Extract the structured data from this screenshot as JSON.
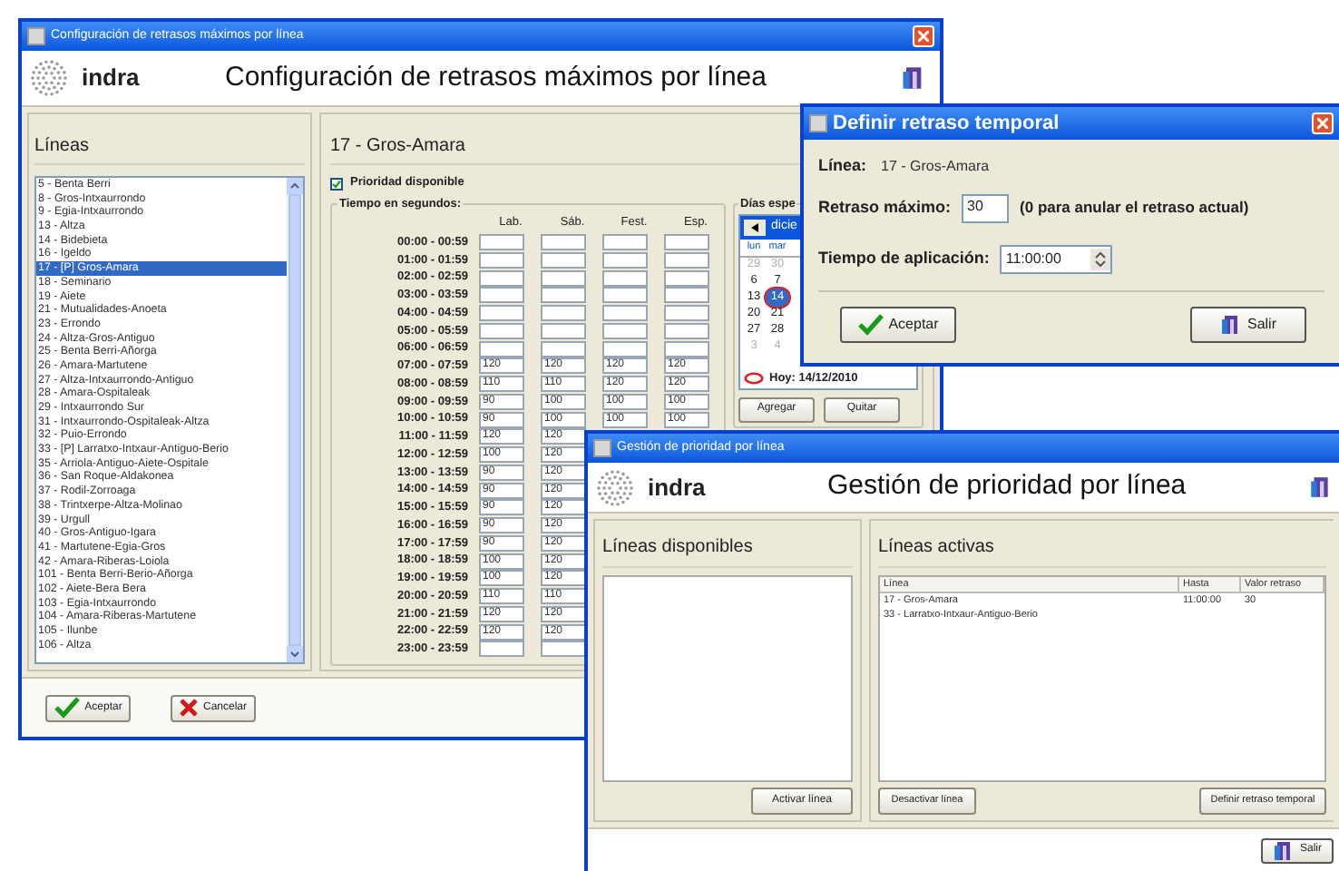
{
  "main_window": {
    "title": "Configuración de retrasos máximos por línea",
    "logo_text": "indra",
    "header_title": "Configuración de retrasos máximos por línea",
    "lines_label": "Líneas",
    "lines": [
      {
        "label": "5 - Benta Berri",
        "selected": false
      },
      {
        "label": "8 - Gros-Intxaurrondo",
        "selected": false
      },
      {
        "label": "9 - Egia-Intxaurrondo",
        "selected": false
      },
      {
        "label": "13 - Altza",
        "selected": false
      },
      {
        "label": "14 - Bidebieta",
        "selected": false
      },
      {
        "label": "16 - Igeldo",
        "selected": false
      },
      {
        "label": "17 - [P] Gros-Amara",
        "selected": true
      },
      {
        "label": "18 - Seminario",
        "selected": false
      },
      {
        "label": "19 - Aiete",
        "selected": false
      },
      {
        "label": "21 - Mutualidades-Anoeta",
        "selected": false
      },
      {
        "label": "23 - Errondo",
        "selected": false
      },
      {
        "label": "24 - Altza-Gros-Antiguo",
        "selected": false
      },
      {
        "label": "25 - Benta Berri-Añorga",
        "selected": false
      },
      {
        "label": "26 - Amara-Martutene",
        "selected": false
      },
      {
        "label": "27 - Altza-Intxaurrondo-Antiguo",
        "selected": false
      },
      {
        "label": "28 - Amara-Ospitaleak",
        "selected": false
      },
      {
        "label": "29 - Intxaurrondo Sur",
        "selected": false
      },
      {
        "label": "31 - Intxaurrondo-Ospitaleak-Altza",
        "selected": false
      },
      {
        "label": "32 - Puio-Errondo",
        "selected": false
      },
      {
        "label": "33 - [P] Larratxo-Intxaur-Antiguo-Berio",
        "selected": false
      },
      {
        "label": "35 - Arriola-Antiguo-Aiete-Ospitale",
        "selected": false
      },
      {
        "label": "36 - San Roque-Aldakonea",
        "selected": false
      },
      {
        "label": "37 - Rodil-Zorroaga",
        "selected": false
      },
      {
        "label": "38 - Trintxerpe-Altza-Molinao",
        "selected": false
      },
      {
        "label": "39 - Urgull",
        "selected": false
      },
      {
        "label": "40 - Gros-Antiguo-Igara",
        "selected": false
      },
      {
        "label": "41 - Martutene-Egia-Gros",
        "selected": false
      },
      {
        "label": "42 - Amara-Riberas-Loiola",
        "selected": false
      },
      {
        "label": "101 - Benta Berri-Berio-Añorga",
        "selected": false
      },
      {
        "label": "102 - Aiete-Bera Bera",
        "selected": false
      },
      {
        "label": "103 - Egia-Intxaurrondo",
        "selected": false
      },
      {
        "label": "104 - Amara-Riberas-Martutene",
        "selected": false
      },
      {
        "label": "105 - Ilunbe",
        "selected": false
      },
      {
        "label": "106 - Altza",
        "selected": false
      }
    ],
    "line_title": "17 - Gros-Amara",
    "priority": {
      "label": "Prioridad disponible",
      "checked": true
    },
    "times_group": "Tiempo en segundos:",
    "columns": [
      "Lab.",
      "Sáb.",
      "Fest.",
      "Esp."
    ],
    "rows": [
      {
        "time": "00:00 - 00:59",
        "cells": [
          {},
          {},
          {},
          {}
        ]
      },
      {
        "time": "01:00 - 01:59",
        "cells": [
          {},
          {},
          {},
          {}
        ]
      },
      {
        "time": "02:00 - 02:59",
        "cells": [
          {},
          {},
          {},
          {}
        ]
      },
      {
        "time": "03:00 - 03:59",
        "cells": [
          {},
          {},
          {},
          {}
        ]
      },
      {
        "time": "04:00 - 04:59",
        "cells": [
          {},
          {},
          {},
          {}
        ]
      },
      {
        "time": "05:00 - 05:59",
        "cells": [
          {},
          {},
          {},
          {}
        ]
      },
      {
        "time": "06:00 - 06:59",
        "cells": [
          {},
          {},
          {},
          {}
        ]
      },
      {
        "time": "07:00 - 07:59",
        "cells": [
          {
            "value": "120"
          },
          {
            "value": "120"
          },
          {
            "value": "120"
          },
          {
            "value": "120"
          }
        ]
      },
      {
        "time": "08:00 - 08:59",
        "cells": [
          {
            "value": "110"
          },
          {
            "value": "110"
          },
          {
            "value": "120"
          },
          {
            "value": "120"
          }
        ]
      },
      {
        "time": "09:00 - 09:59",
        "cells": [
          {
            "value": "90"
          },
          {
            "value": "100"
          },
          {
            "value": "100"
          },
          {
            "value": "100"
          }
        ]
      },
      {
        "time": "10:00 - 10:59",
        "cells": [
          {
            "value": "90"
          },
          {
            "value": "100"
          },
          {
            "value": "100"
          },
          {
            "value": "100"
          }
        ]
      },
      {
        "time": "11:00 - 11:59",
        "cells": [
          {
            "value": "120"
          },
          {
            "value": "120"
          }
        ]
      },
      {
        "time": "12:00 - 12:59",
        "cells": [
          {
            "value": "100"
          },
          {
            "value": "120"
          }
        ]
      },
      {
        "time": "13:00 - 13:59",
        "cells": [
          {
            "value": "90"
          },
          {
            "value": "120"
          }
        ]
      },
      {
        "time": "14:00 - 14:59",
        "cells": [
          {
            "value": "90"
          },
          {
            "value": "120"
          }
        ]
      },
      {
        "time": "15:00 - 15:59",
        "cells": [
          {
            "value": "90"
          },
          {
            "value": "120"
          }
        ]
      },
      {
        "time": "16:00 - 16:59",
        "cells": [
          {
            "value": "90"
          },
          {
            "value": "120"
          }
        ]
      },
      {
        "time": "17:00 - 17:59",
        "cells": [
          {
            "value": "90"
          },
          {
            "value": "120"
          }
        ]
      },
      {
        "time": "18:00 - 18:59",
        "cells": [
          {
            "value": "100"
          },
          {
            "value": "120"
          }
        ]
      },
      {
        "time": "19:00 - 19:59",
        "cells": [
          {
            "value": "100"
          },
          {
            "value": "120"
          }
        ]
      },
      {
        "time": "20:00 - 20:59",
        "cells": [
          {
            "value": "110"
          },
          {
            "value": "110"
          }
        ]
      },
      {
        "time": "21:00 - 21:59",
        "cells": [
          {
            "value": "120"
          },
          {
            "value": "120"
          }
        ]
      },
      {
        "time": "22:00 - 22:59",
        "cells": [
          {
            "value": "120"
          },
          {
            "value": "120"
          }
        ]
      },
      {
        "time": "23:00 - 23:59",
        "cells": [
          {},
          {}
        ]
      }
    ],
    "calendar": {
      "group": "Días espe",
      "month": "dicie",
      "weekdays": [
        "lun",
        "mar"
      ],
      "weeks": [
        [
          {
            "day": "29",
            "muted": true,
            "selected": false
          },
          {
            "day": "30",
            "muted": true,
            "selected": false
          }
        ],
        [
          {
            "day": "6",
            "muted": false,
            "selected": false
          },
          {
            "day": "7",
            "muted": false,
            "selected": false
          }
        ],
        [
          {
            "day": "13",
            "muted": false,
            "selected": false
          },
          {
            "day": "14",
            "muted": false,
            "selected": true
          }
        ],
        [
          {
            "day": "20",
            "muted": false,
            "selected": false
          },
          {
            "day": "21",
            "muted": false,
            "selected": false
          }
        ],
        [
          {
            "day": "27",
            "muted": false,
            "selected": false
          },
          {
            "day": "28",
            "muted": false,
            "selected": false
          }
        ],
        [
          {
            "day": "3",
            "muted": true,
            "selected": false
          },
          {
            "day": "4",
            "muted": true,
            "selected": false
          }
        ]
      ],
      "today": "Hoy: 14/12/2010",
      "buttons": [
        "Agregar",
        "Quitar"
      ]
    },
    "buttons": [
      {
        "label": "Aceptar",
        "kind": "accept"
      },
      {
        "label": "Cancelar",
        "kind": "cancel"
      }
    ]
  },
  "delay_dialog": {
    "title": "Definir retraso temporal",
    "line_label": "Línea:",
    "line_value": "17 - Gros-Amara",
    "max_label": "Retraso máximo:",
    "max_value": "30",
    "max_hint": "(0 para anular el retraso actual)",
    "time_label": "Tiempo de aplicación:",
    "time_value": "11:00:00",
    "buttons": [
      {
        "label": "Aceptar",
        "kind": "accept"
      },
      {
        "label": "Salir",
        "kind": "exit"
      }
    ]
  },
  "priority_window": {
    "title": "Gestión de prioridad por línea",
    "logo_text": "indra",
    "header_title": "Gestión de prioridad por línea",
    "available": {
      "label": "Líneas disponibles",
      "button": "Activar línea"
    },
    "active": {
      "label": "Líneas activas",
      "columns": [
        "Línea",
        "Hasta",
        "Valor retraso"
      ],
      "rows": [
        [
          "17 - Gros-Amara",
          "11:00:00",
          "30"
        ],
        [
          "33 - Larratxo-Intxaur-Antiguo-Berio"
        ]
      ],
      "buttons": [
        "Desactivar línea",
        "Definir retraso temporal"
      ]
    },
    "exit_button": {
      "label": "Salir",
      "kind": "exit"
    }
  }
}
